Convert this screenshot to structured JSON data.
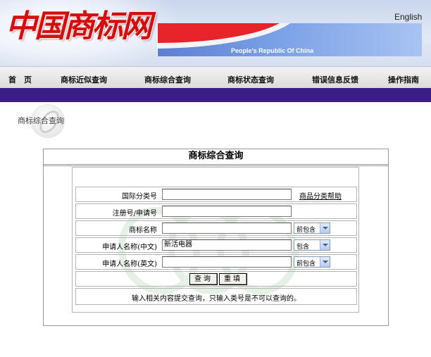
{
  "banner": {
    "logo_text": "中国商标网",
    "english_link": "English",
    "flag_caption": "People's Republic Of China"
  },
  "nav": {
    "items": [
      {
        "label": "首　页"
      },
      {
        "label": "商标近似查询"
      },
      {
        "label": "商标综合查询"
      },
      {
        "label": "商标状态查询"
      },
      {
        "label": "错误信息反馈"
      },
      {
        "label": "操作指南"
      }
    ]
  },
  "section": {
    "title": "商标综合查询"
  },
  "form": {
    "title": "商标综合查询",
    "rows": [
      {
        "label": "国际分类号",
        "value": "",
        "help_link": "商品分类帮助"
      },
      {
        "label": "注册号/申请号",
        "value": ""
      },
      {
        "label": "商标名称",
        "value": "",
        "match": "前包含"
      },
      {
        "label": "申请人名称(中文)",
        "value": "新活电器",
        "match": "包含"
      },
      {
        "label": "申请人名称(英文)",
        "value": "",
        "match": "前包含"
      }
    ],
    "buttons": {
      "search": "查询",
      "reset": "重填"
    },
    "hint": "输入相关内容提交查询，只输入类号是不可以查询的。"
  },
  "colors": {
    "nav_bar": "#3b1e84",
    "logo_red": "#d60d0d",
    "flag_blue": "#6a8fdc"
  }
}
